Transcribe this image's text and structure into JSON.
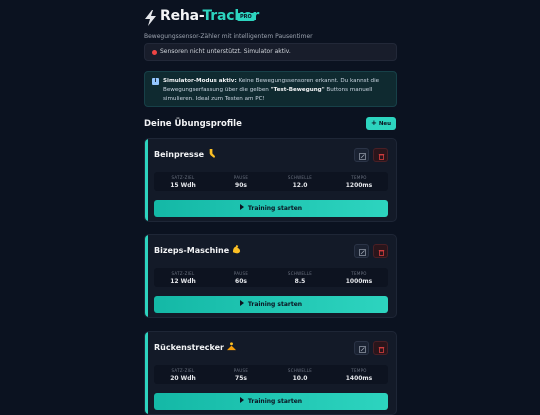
{
  "app": {
    "title_main": "Reha-",
    "title_accent": "Tracker",
    "badge": "PRO",
    "subtitle": "Bewegungssensor-Zähler mit intelligentem Pausentimer"
  },
  "alert": {
    "text": "Sensoren nicht unterstützt. Simulator aktiv."
  },
  "info": {
    "bold_lead": "Simulator-Modus aktiv:",
    "text_1": " Keine Bewegungssensoren erkannt. Du kannst die Bewegungserfassung über die gelben ",
    "bold_button": "\"Test-Bewegung\"",
    "text_2": " Buttons manuell simulieren. Ideal zum Testen am PC!"
  },
  "section": {
    "title": "Deine Übungsprofile",
    "new_label": "Neu"
  },
  "labels": {
    "sets": "SATZ-ZIEL",
    "pause": "PAUSE",
    "threshold": "SCHWELLE",
    "tempo": "TEMPO",
    "train": "Training starten"
  },
  "profiles": [
    {
      "name": "Beinpresse",
      "emoji": "leg-icon",
      "sets": "15 Wdh",
      "pause": "90s",
      "threshold": "12.0",
      "tempo": "1200ms"
    },
    {
      "name": "Bizeps-Maschine",
      "emoji": "flexed-biceps-icon",
      "sets": "12 Wdh",
      "pause": "60s",
      "threshold": "8.5",
      "tempo": "1000ms"
    },
    {
      "name": "Rückenstrecker",
      "emoji": "person-lotus-icon",
      "sets": "20 Wdh",
      "pause": "75s",
      "threshold": "10.0",
      "tempo": "1400ms"
    }
  ],
  "colors": {
    "accent": "#2dd4bf",
    "danger": "#ef4444",
    "background": "#0b1220"
  }
}
